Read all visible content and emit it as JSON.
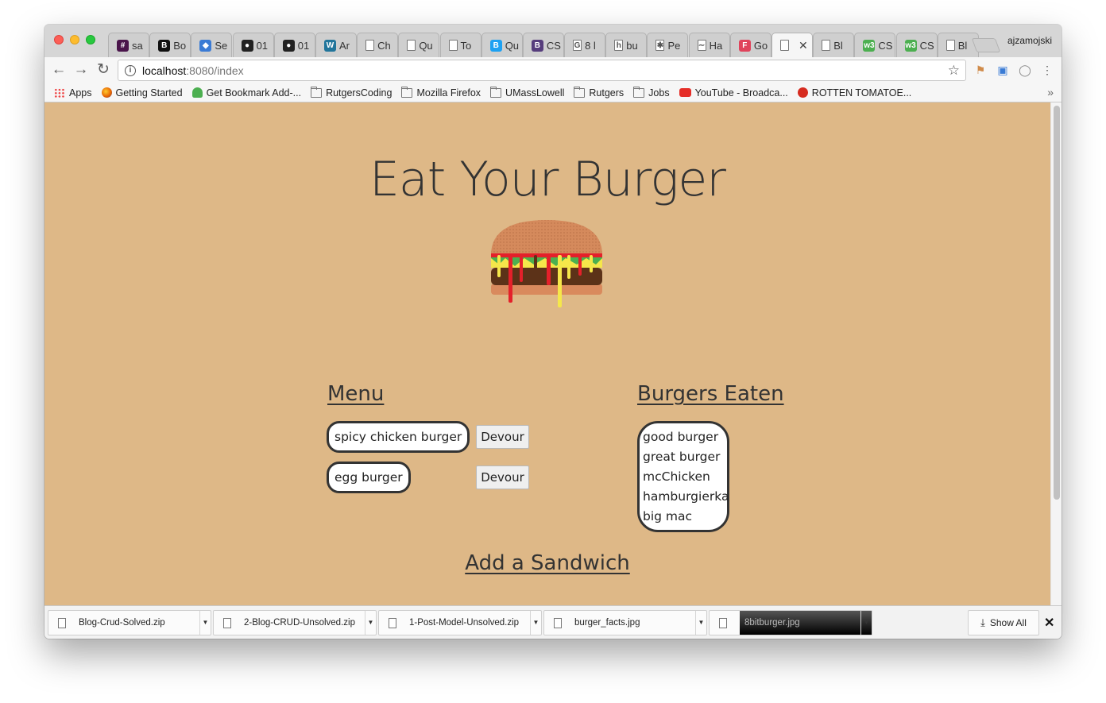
{
  "browser": {
    "profile_name": "ajzamojski",
    "tabs": [
      {
        "label": "sa",
        "icon": "slack-icon",
        "color": "#4a154b",
        "glyph": "#"
      },
      {
        "label": "Bo",
        "icon": "bootstrap-b-icon",
        "color": "#111111",
        "glyph": "B"
      },
      {
        "label": "Se",
        "icon": "cube-icon",
        "color": "#3a7bd5",
        "glyph": "◆"
      },
      {
        "label": "01",
        "icon": "github-icon",
        "color": "#222222",
        "glyph": "●"
      },
      {
        "label": "01",
        "icon": "github-icon",
        "color": "#222222",
        "glyph": "●"
      },
      {
        "label": "Ar",
        "icon": "wordpress-icon",
        "color": "#21759b",
        "glyph": "W"
      },
      {
        "label": "Ch",
        "icon": "page-icon",
        "color": "#ffffff",
        "glyph": ""
      },
      {
        "label": "Qu",
        "icon": "page-icon",
        "color": "#ffffff",
        "glyph": ""
      },
      {
        "label": "To",
        "icon": "page-icon",
        "color": "#ffffff",
        "glyph": ""
      },
      {
        "label": "Qu",
        "icon": "b-blue-icon",
        "color": "#1da1f2",
        "glyph": "B"
      },
      {
        "label": "CS",
        "icon": "bootstrap-icon",
        "color": "#563d7c",
        "glyph": "B"
      },
      {
        "label": "8 l",
        "icon": "google-icon",
        "color": "#ffffff",
        "glyph": "G"
      },
      {
        "label": "bu",
        "icon": "h-icon",
        "color": "#ffffff",
        "glyph": "h"
      },
      {
        "label": "Pe",
        "icon": "asterisk-icon",
        "color": "#ffffff",
        "glyph": "✱"
      },
      {
        "label": "Ha",
        "icon": "wave-icon",
        "color": "#ffffff",
        "glyph": "∼"
      },
      {
        "label": "Go",
        "icon": "f-red-icon",
        "color": "#e0435b",
        "glyph": "F"
      },
      {
        "label": "",
        "icon": "page-icon",
        "color": "#ffffff",
        "glyph": "",
        "active": true
      },
      {
        "label": "Bl",
        "icon": "page-icon",
        "color": "#ffffff",
        "glyph": ""
      },
      {
        "label": "CS",
        "icon": "w3-icon",
        "color": "#4caf50",
        "glyph": "w3"
      },
      {
        "label": "CS",
        "icon": "w3-icon",
        "color": "#4caf50",
        "glyph": "w3"
      },
      {
        "label": "Bl",
        "icon": "page-icon",
        "color": "#ffffff",
        "glyph": ""
      }
    ],
    "url_host": "localhost",
    "url_path": ":8080/index",
    "bookmarks": [
      {
        "label": "Apps",
        "icon": "apps-grid-icon"
      },
      {
        "label": "Getting Started",
        "icon": "firefox-icon"
      },
      {
        "label": "Get Bookmark Add-...",
        "icon": "addon-icon"
      },
      {
        "label": "RutgersCoding",
        "icon": "folder-icon"
      },
      {
        "label": "Mozilla Firefox",
        "icon": "folder-icon"
      },
      {
        "label": "UMassLowell",
        "icon": "folder-icon"
      },
      {
        "label": "Rutgers",
        "icon": "folder-icon"
      },
      {
        "label": "Jobs",
        "icon": "folder-icon"
      },
      {
        "label": "YouTube - Broadca...",
        "icon": "youtube-icon"
      },
      {
        "label": "ROTTEN TOMATOE...",
        "icon": "tomato-icon"
      }
    ]
  },
  "page": {
    "background": "#deb887",
    "title": "Eat Your Burger",
    "menu_heading": "Menu",
    "menu_items": [
      {
        "name": "spicy chicken burger",
        "button": "Devour"
      },
      {
        "name": "egg burger",
        "button": "Devour"
      }
    ],
    "eaten_heading": "Burgers Eaten",
    "eaten_items": [
      "good burger",
      "great burger",
      "mcChicken",
      "hamburgierka",
      "big mac"
    ],
    "add_heading": "Add a Sandwich"
  },
  "downloads": {
    "files": [
      {
        "name": "Blog-Crud-Solved.zip"
      },
      {
        "name": "2-Blog-CRUD-Unsolved.zip"
      },
      {
        "name": "1-Post-Model-Unsolved.zip"
      },
      {
        "name": "burger_facts.jpg"
      },
      {
        "name": "8bitburger.jpg"
      }
    ],
    "show_all": "Show All"
  }
}
